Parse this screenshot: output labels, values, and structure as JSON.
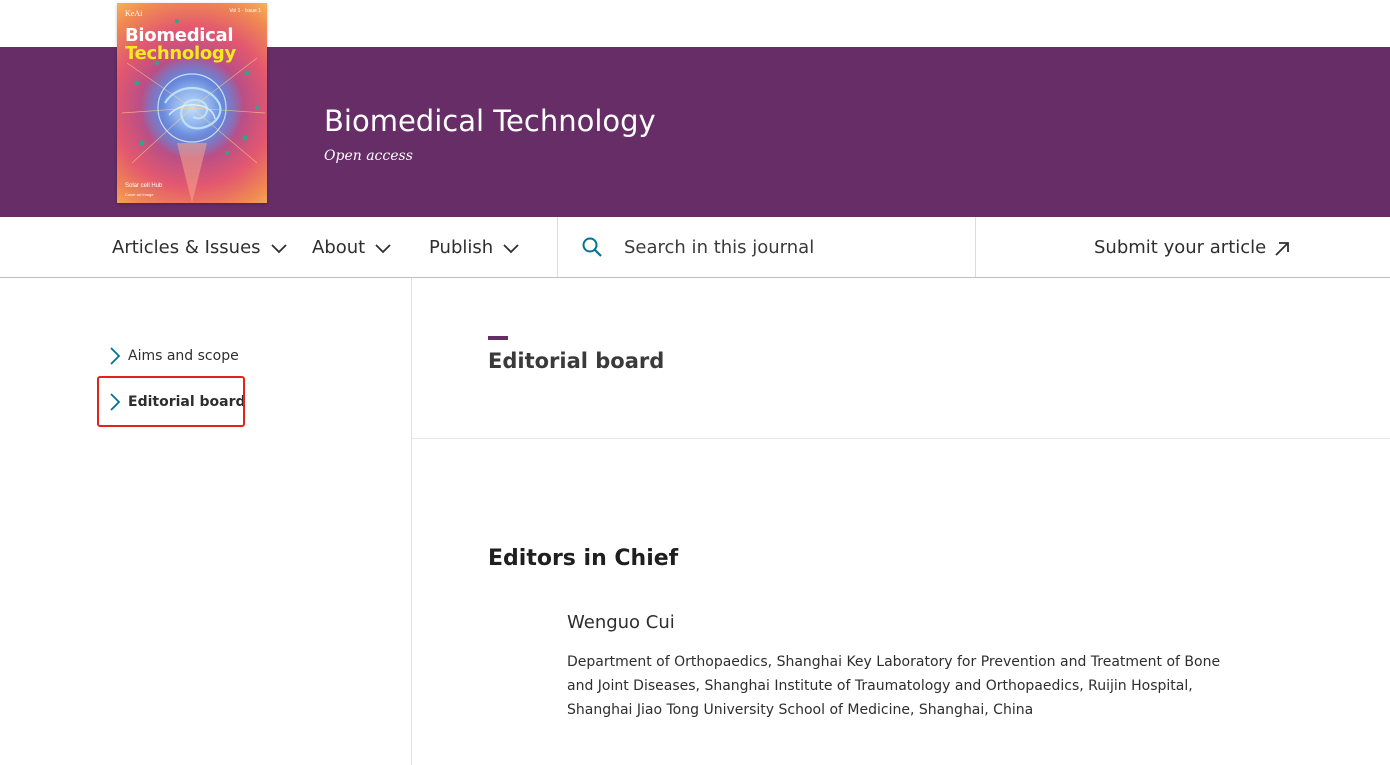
{
  "journal": {
    "title": "Biomedical Technology",
    "access": "Open access",
    "brand_color": "#662d67"
  },
  "cover": {
    "publisher": "KeAi",
    "title_line1": "Biomedical",
    "title_line2": "Technology",
    "issue": "Vol 1 · Issue 1",
    "footer": "Solar cell Hub",
    "footer_small": "Cover art image"
  },
  "nav": {
    "items": [
      {
        "label": "Articles & Issues",
        "icon": "chevron-down-icon"
      },
      {
        "label": "About",
        "icon": "chevron-down-icon"
      },
      {
        "label": "Publish",
        "icon": "chevron-down-icon"
      }
    ],
    "search_placeholder": "Search in this journal",
    "search_icon": "search-icon",
    "submit_label": "Submit your article",
    "submit_icon": "external-arrow-icon",
    "accent_color": "#007398"
  },
  "sidebar": {
    "items": [
      {
        "label": "Aims and scope",
        "active": false
      },
      {
        "label": "Editorial board",
        "active": true
      }
    ],
    "highlight_color": "#e2231a"
  },
  "main": {
    "page_title": "Editorial board",
    "section_heading": "Editors in Chief",
    "editors": [
      {
        "name": "Wenguo Cui",
        "affiliation": "Department of Orthopaedics, Shanghai Key Laboratory for Prevention and Treatment of Bone and Joint Diseases, Shanghai Institute of Traumatology and Orthopaedics, Ruijin Hospital, Shanghai Jiao Tong University School of Medicine, Shanghai, China"
      }
    ]
  }
}
